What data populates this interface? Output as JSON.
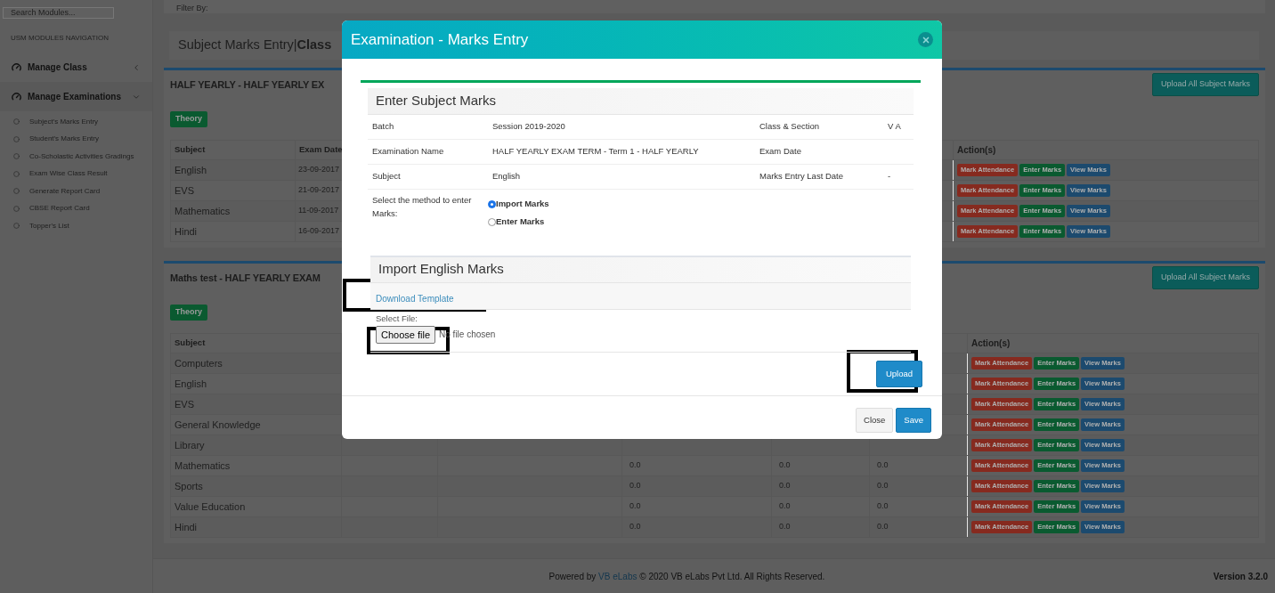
{
  "sidebar": {
    "search": {
      "placeholder": "Search Modules..."
    },
    "nav_header": "USM MODULES NAVIGATION",
    "groups": [
      {
        "label": "Manage Class",
        "expanded": false
      },
      {
        "label": "Manage Examinations",
        "expanded": true,
        "children": [
          {
            "label": "Subject's Marks Entry"
          },
          {
            "label": "Student's Marks Entry"
          },
          {
            "label": "Co-Scholastic Activities Gradings"
          },
          {
            "label": "Exam Wise Class Result"
          },
          {
            "label": "Generate Report Card"
          },
          {
            "label": "CBSE Report Card"
          },
          {
            "label": "Topper's List"
          }
        ]
      }
    ]
  },
  "filter_bar": {
    "label": "Filter By:"
  },
  "page_title": "Subject Marks Entry|**Class**",
  "panels": [
    {
      "kind": "dated",
      "title": "HALF YEARLY - HALF YEARLY EX",
      "button": "Upload All Subject Marks",
      "badge": "Theory",
      "columns": [
        "Subject",
        "Exam Date"
      ],
      "action_header": "Action(s)",
      "rows": [
        {
          "subject": "English",
          "exam_date": "23-09-2017",
          "actions": [
            {
              "label": "Mark Attendance",
              "color": "#862a1f"
            },
            {
              "label": "Enter Marks",
              "color": "#0a5a30"
            },
            {
              "label": "View Marks",
              "color": "#1c4a6e"
            }
          ]
        },
        {
          "subject": "EVS",
          "exam_date": "21-09-2017",
          "actions": [
            {
              "label": "Mark Attendance",
              "color": "#862a1f"
            },
            {
              "label": "Enter Marks",
              "color": "#0a5a30"
            },
            {
              "label": "View Marks",
              "color": "#1c4a6e"
            }
          ]
        },
        {
          "subject": "Mathematics",
          "exam_date": "11-09-2017",
          "actions": [
            {
              "label": "Mark Attendance",
              "color": "#862a1f"
            },
            {
              "label": "Enter Marks",
              "color": "#0a5a30"
            },
            {
              "label": "View Marks",
              "color": "#1c4a6e"
            }
          ]
        },
        {
          "subject": "Hindi",
          "exam_date": "16-09-2017",
          "actions": [
            {
              "label": "Mark Attendance",
              "color": "#862a1f"
            },
            {
              "label": "Enter Marks",
              "color": "#0a5a30"
            },
            {
              "label": "View Marks",
              "color": "#1c4a6e"
            }
          ]
        }
      ]
    },
    {
      "kind": "marks",
      "title": "Maths test - HALF YEARLY EXAM",
      "button": "Upload All Subject Marks",
      "badge": "Theory",
      "columns": [
        "Subject"
      ],
      "action_header": "Action(s)",
      "rows": [
        {
          "subject": "Computers",
          "actions": [
            {
              "label": "Mark Attendance",
              "color": "#862a1f"
            },
            {
              "label": "Enter Marks",
              "color": "#0a5a30"
            },
            {
              "label": "View Marks",
              "color": "#1c4a6e"
            }
          ]
        },
        {
          "subject": "English",
          "actions": [
            {
              "label": "Mark Attendance",
              "color": "#862a1f"
            },
            {
              "label": "Enter Marks",
              "color": "#0a5a30"
            },
            {
              "label": "View Marks",
              "color": "#1c4a6e"
            }
          ]
        },
        {
          "subject": "EVS",
          "actions": [
            {
              "label": "Mark Attendance",
              "color": "#862a1f"
            },
            {
              "label": "Enter Marks",
              "color": "#0a5a30"
            },
            {
              "label": "View Marks",
              "color": "#1c4a6e"
            }
          ]
        },
        {
          "subject": "General Knowledge",
          "actions": [
            {
              "label": "Mark Attendance",
              "color": "#862a1f"
            },
            {
              "label": "Enter Marks",
              "color": "#0a5a30"
            },
            {
              "label": "View Marks",
              "color": "#1c4a6e"
            }
          ]
        },
        {
          "subject": "Library",
          "actions": [
            {
              "label": "Mark Attendance",
              "color": "#862a1f"
            },
            {
              "label": "Enter Marks",
              "color": "#0a5a30"
            },
            {
              "label": "View Marks",
              "color": "#1c4a6e"
            }
          ]
        },
        {
          "subject": "Mathematics",
          "marks": [
            "0.0",
            "0.0",
            "0.0"
          ],
          "actions": [
            {
              "label": "Mark Attendance",
              "color": "#862a1f"
            },
            {
              "label": "Enter Marks",
              "color": "#0a5a30"
            },
            {
              "label": "View Marks",
              "color": "#1c4a6e"
            }
          ]
        },
        {
          "subject": "Sports",
          "marks": [
            "0.0",
            "0.0",
            "0.0"
          ],
          "actions": [
            {
              "label": "Mark Attendance",
              "color": "#862a1f"
            },
            {
              "label": "Enter Marks",
              "color": "#0a5a30"
            },
            {
              "label": "View Marks",
              "color": "#1c4a6e"
            }
          ]
        },
        {
          "subject": "Value Education",
          "marks": [
            "0.0",
            "0.0",
            "0.0"
          ],
          "actions": [
            {
              "label": "Mark Attendance",
              "color": "#862a1f"
            },
            {
              "label": "Enter Marks",
              "color": "#0a5a30"
            },
            {
              "label": "View Marks",
              "color": "#1c4a6e"
            }
          ]
        },
        {
          "subject": "Hindi",
          "marks": [
            "0.0",
            "0.0",
            "0.0"
          ],
          "actions": [
            {
              "label": "Mark Attendance",
              "color": "#862a1f"
            },
            {
              "label": "Enter Marks",
              "color": "#0a5a30"
            },
            {
              "label": "View Marks",
              "color": "#1c4a6e"
            }
          ]
        }
      ]
    }
  ],
  "footer": {
    "prefix": "Powered by",
    "link": "VB eLabs",
    "suffix": "© 2020 VB eLabs Pvt Ltd. All Rights Reserved.",
    "version": "Version 3.2.0"
  },
  "modal": {
    "title": "Examination - Marks Entry",
    "section_title": "Enter Subject Marks",
    "details": [
      {
        "label": "Batch",
        "value": "Session 2019-2020",
        "label_2": "Class & Section",
        "value_2": "V A"
      },
      {
        "label": "Examination Name",
        "value": "HALF YEARLY EXAM TERM - Term 1 - HALF YEARLY",
        "label_2": "Exam Date"
      },
      {
        "label": "Subject",
        "value": "English",
        "label_2": "Marks Entry Last Date",
        "value_2": "-"
      }
    ],
    "method_label": "Select the method to enter Marks:",
    "methods": [
      {
        "label": "Import Marks",
        "selected": true
      },
      {
        "label": "Enter Marks",
        "selected": false
      }
    ],
    "import": {
      "title": "Import English Marks",
      "template_link": "Download Template",
      "file_label": "Select File:",
      "file_button": "Choose file",
      "file_status": "No file chosen",
      "upload": "Upload"
    },
    "buttons": [
      {
        "label": "Close",
        "kind": "default"
      },
      {
        "label": "Save",
        "kind": "primary"
      }
    ]
  }
}
